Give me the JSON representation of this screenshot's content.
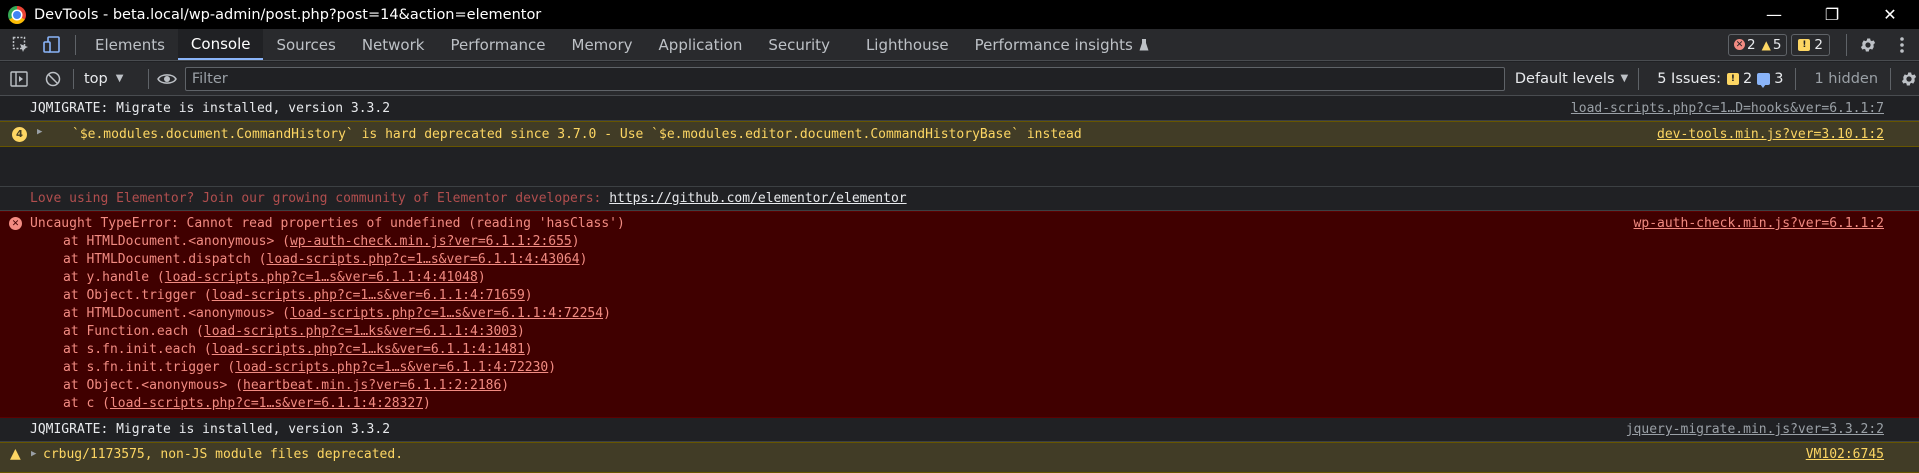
{
  "window": {
    "title": "DevTools - beta.local/wp-admin/post.php?post=14&action=elementor",
    "minimize": "—",
    "maximize": "❐",
    "close": "✕"
  },
  "tabs": [
    {
      "label": "Elements"
    },
    {
      "label": "Console"
    },
    {
      "label": "Sources"
    },
    {
      "label": "Network"
    },
    {
      "label": "Performance"
    },
    {
      "label": "Memory"
    },
    {
      "label": "Application"
    },
    {
      "label": "Security"
    },
    {
      "label": "Lighthouse"
    },
    {
      "label": "Performance insights"
    }
  ],
  "active_tab": "Console",
  "counts": {
    "errors": "2",
    "warnings": "5",
    "issues": "2"
  },
  "toolbar": {
    "context": "top",
    "filter_placeholder": "Filter",
    "levels": "Default levels",
    "issues_label": "5 Issues:",
    "issues_warn": "2",
    "issues_info": "3",
    "hidden": "1 hidden"
  },
  "messages": {
    "m1": {
      "text": "JQMIGRATE: Migrate is installed, version 3.3.2",
      "source": "load-scripts.php?c=1…D=hooks&ver=6.1.1:7"
    },
    "m2": {
      "badge": "4",
      "text": "`$e.modules.document.CommandHistory` is hard deprecated since 3.7.0 - Use `$e.modules.editor.document.CommandHistoryBase` instead",
      "source": "dev-tools.min.js?ver=3.10.1:2"
    },
    "m3": {
      "text": "Love using Elementor? Join our growing community of Elementor developers: ",
      "link": "https://github.com/elementor/elementor"
    },
    "m4": {
      "text": "Uncaught TypeError: Cannot read properties of undefined (reading 'hasClass')",
      "source": "wp-auth-check.min.js?ver=6.1.1:2",
      "stack": [
        {
          "pre": "at HTMLDocument.<anonymous> (",
          "link": "wp-auth-check.min.js?ver=6.1.1:2:655",
          "post": ")"
        },
        {
          "pre": "at HTMLDocument.dispatch (",
          "link": "load-scripts.php?c=1…s&ver=6.1.1:4:43064",
          "post": ")"
        },
        {
          "pre": "at y.handle (",
          "link": "load-scripts.php?c=1…s&ver=6.1.1:4:41048",
          "post": ")"
        },
        {
          "pre": "at Object.trigger (",
          "link": "load-scripts.php?c=1…s&ver=6.1.1:4:71659",
          "post": ")"
        },
        {
          "pre": "at HTMLDocument.<anonymous> (",
          "link": "load-scripts.php?c=1…s&ver=6.1.1:4:72254",
          "post": ")"
        },
        {
          "pre": "at Function.each (",
          "link": "load-scripts.php?c=1…ks&ver=6.1.1:4:3003",
          "post": ")"
        },
        {
          "pre": "at s.fn.init.each (",
          "link": "load-scripts.php?c=1…ks&ver=6.1.1:4:1481",
          "post": ")"
        },
        {
          "pre": "at s.fn.init.trigger (",
          "link": "load-scripts.php?c=1…s&ver=6.1.1:4:72230",
          "post": ")"
        },
        {
          "pre": "at Object.<anonymous> (",
          "link": "heartbeat.min.js?ver=6.1.1:2:2186",
          "post": ")"
        },
        {
          "pre": "at c (",
          "link": "load-scripts.php?c=1…s&ver=6.1.1:4:28327",
          "post": ")"
        }
      ]
    },
    "m5": {
      "text": "JQMIGRATE: Migrate is installed, version 3.3.2",
      "source": "jquery-migrate.min.js?ver=3.3.2:2"
    },
    "m6": {
      "text": "crbug/1173575, non-JS module files deprecated.",
      "source": "VM102:6745"
    }
  }
}
